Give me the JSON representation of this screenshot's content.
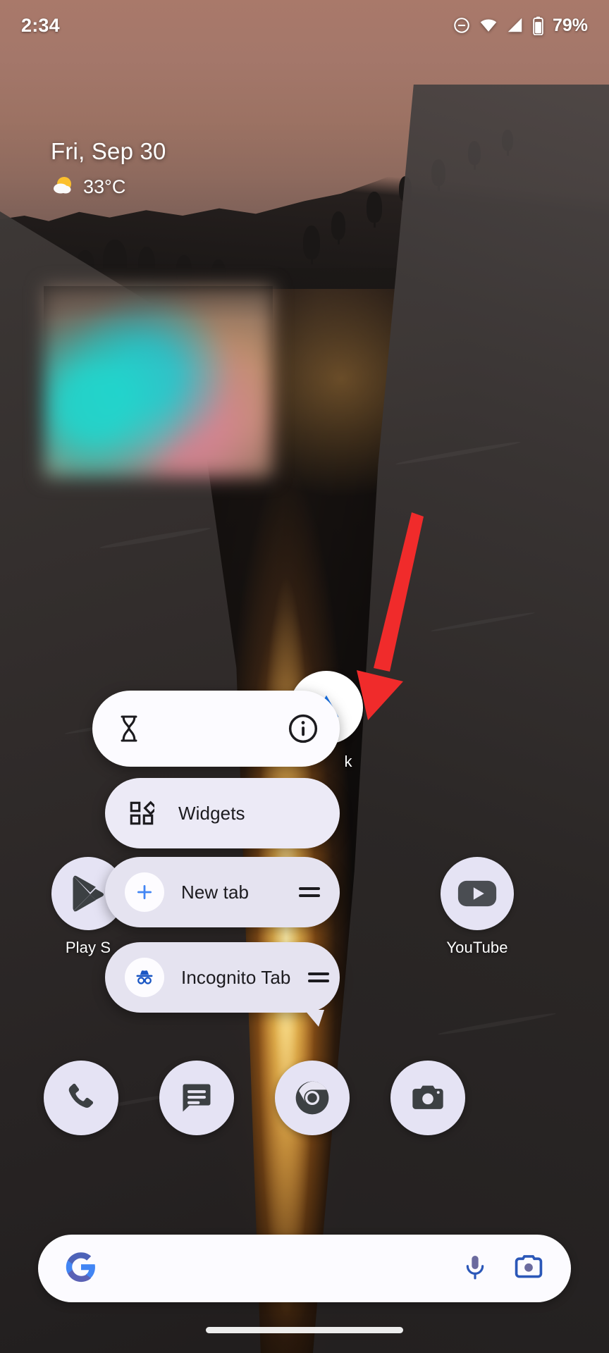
{
  "status_bar": {
    "time": "2:34",
    "battery_percent": "79%",
    "icons": [
      "dnd-icon",
      "wifi-icon",
      "signal-icon",
      "battery-icon"
    ]
  },
  "at_a_glance": {
    "date": "Fri, Sep 30",
    "temperature": "33°C",
    "weather_icon": "sun-behind-cloud-icon"
  },
  "photo_widget": {
    "alt": "blurred photo widget"
  },
  "home_apps": [
    {
      "label": "Play S",
      "icon": "play-store-icon"
    },
    {
      "label": "YouTube",
      "icon": "youtube-icon"
    },
    {
      "label": "k",
      "icon": "hidden-app-icon"
    }
  ],
  "popup_menu": {
    "items": [
      {
        "label": "",
        "left_icon": "hourglass-icon",
        "right_icon": "info-icon",
        "has_drag_handle": false
      },
      {
        "label": "Widgets",
        "left_icon": "widgets-icon",
        "right_icon": "",
        "has_drag_handle": false
      },
      {
        "label": "New tab",
        "left_icon": "plus-icon",
        "right_icon": "drag-handle-icon",
        "has_drag_handle": true
      },
      {
        "label": "Incognito Tab",
        "left_icon": "incognito-icon",
        "right_icon": "drag-handle-icon",
        "has_drag_handle": true
      }
    ]
  },
  "annotation": {
    "arrow_color": "#F02B2B",
    "points_to": "info-icon"
  },
  "dock": [
    {
      "label": "Phone",
      "icon": "phone-icon"
    },
    {
      "label": "Messages",
      "icon": "messages-icon"
    },
    {
      "label": "Chrome",
      "icon": "chrome-icon"
    },
    {
      "label": "Camera",
      "icon": "camera-icon"
    }
  ],
  "search_bar": {
    "logo": "google-g-icon",
    "mic_icon": "microphone-icon",
    "lens_icon": "google-lens-icon",
    "placeholder": ""
  },
  "nav": {
    "pill": "gesture-nav-pill"
  },
  "colors": {
    "accent_blue": "#4285F4",
    "card_light": "#FCFBFF",
    "card_gray": "#E5E3F0",
    "icon_circle": "#E5E3F4",
    "arrow_red": "#F02B2B"
  }
}
